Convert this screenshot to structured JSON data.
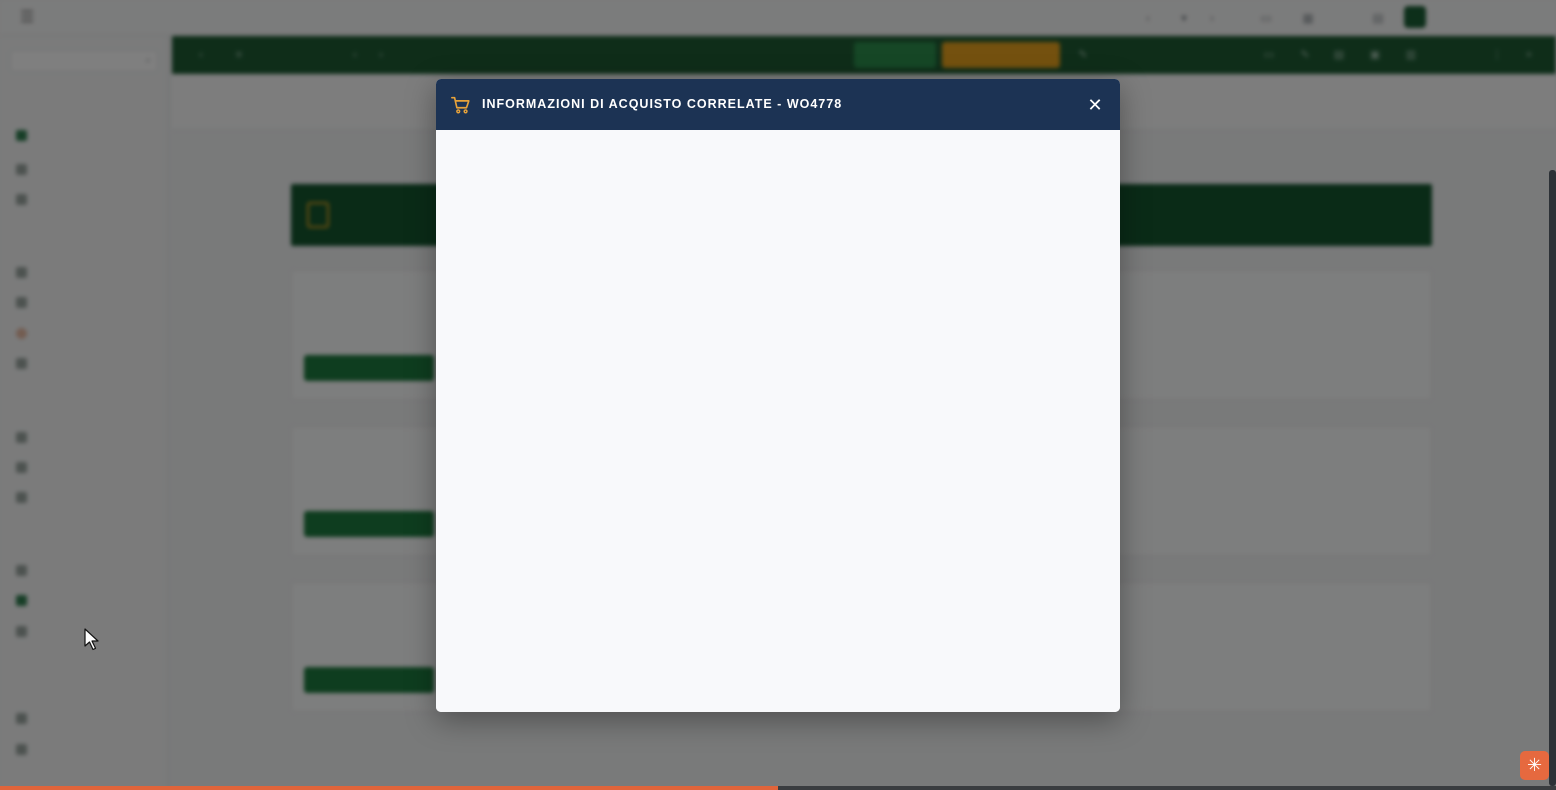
{
  "modal": {
    "title": "INFORMAZIONI DI ACQUISTO CORRELATE - WO4778",
    "icon": "shopping-cart-icon",
    "close_glyph": "✕"
  },
  "progress": {
    "fraction": 0.5
  },
  "colors": {
    "modal_header": "#1c3354",
    "cart_icon": "#e8a33a",
    "toolbar_green": "#1e5b33",
    "accent_orange": "#e8a21e",
    "progress_fill": "#e0643a",
    "corner_button": "#e6693f"
  }
}
